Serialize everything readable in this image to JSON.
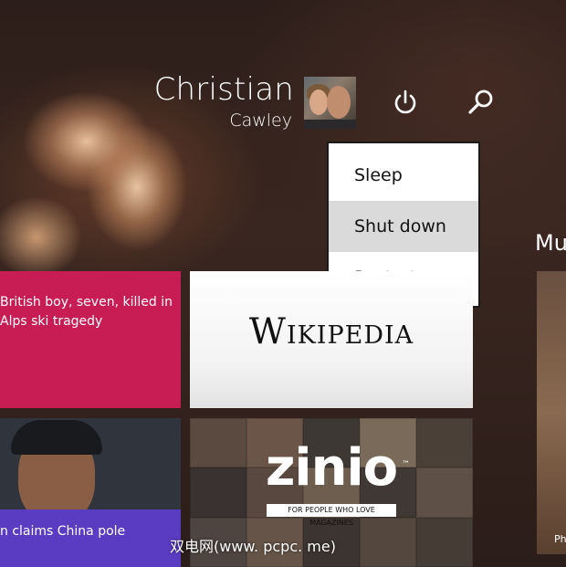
{
  "header": {
    "user_first_name": "Christian",
    "user_last_name": "Cawley",
    "power_icon": "power-icon",
    "search_icon": "search-icon"
  },
  "power_menu": {
    "items": [
      {
        "label": "Sleep"
      },
      {
        "label": "Shut down"
      },
      {
        "label": "Restart"
      }
    ],
    "selected_index": 1
  },
  "partial_section_label": "Mu",
  "tiles": {
    "news_headline": "British boy, seven, killed in Alps ski tragedy",
    "wiki_wordmark": "Wikipedia",
    "sport_headline": "n claims China pole",
    "zinio_logo": "zinio",
    "zinio_tm": "™",
    "zinio_tagline": "FOR PEOPLE WHO LOVE MAGAZINES",
    "right_tile_caption": "Ph"
  },
  "watermark": "双电网(www. pcpc. me)",
  "colors": {
    "news_tile": "#c81c55",
    "sport_bar": "#5a3cc2",
    "menu_selected": "#dadada"
  }
}
